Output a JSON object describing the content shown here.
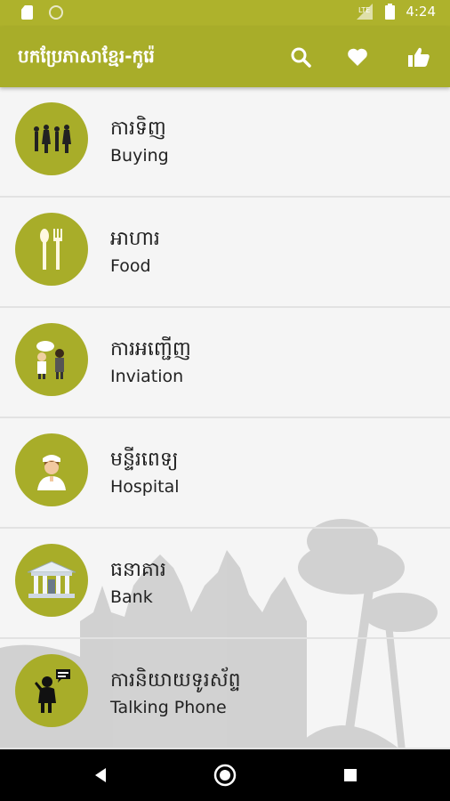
{
  "status_bar": {
    "time": "4:24"
  },
  "app_bar": {
    "title": "បកប្រែភាសាខ្មែរ-កូរ៉េ",
    "actions": [
      "search-icon",
      "heart-icon",
      "thumbs-up-icon"
    ]
  },
  "categories": [
    {
      "khmer": "ការទិញ",
      "english": "Buying",
      "icon": "shopping-people-icon"
    },
    {
      "khmer": "អាហារ",
      "english": "Food",
      "icon": "spoon-fork-icon"
    },
    {
      "khmer": "ការអញ្ជើញ",
      "english": "Inviation",
      "icon": "invitation-people-icon"
    },
    {
      "khmer": "មន្ទីរពេទ្យ",
      "english": "Hospital",
      "icon": "nurse-icon"
    },
    {
      "khmer": "ធនាគារ",
      "english": "Bank",
      "icon": "bank-building-icon"
    },
    {
      "khmer": "ការនិយាយទូរស័ព្ទ",
      "english": "Talking Phone",
      "icon": "phone-talk-icon"
    }
  ],
  "colors": {
    "primary": "#a8ad29",
    "status_bar": "#aeb22c",
    "background": "#f5f5f5"
  }
}
